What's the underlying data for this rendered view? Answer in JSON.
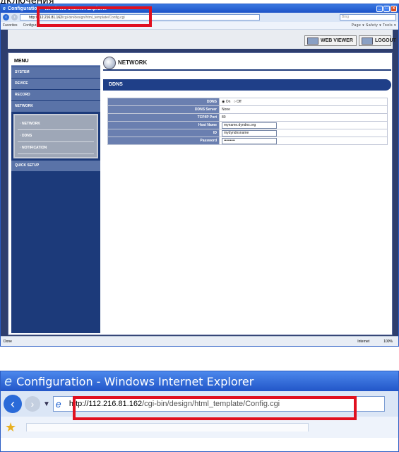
{
  "caption": "дключения",
  "browser": {
    "title": "Configuration - Windows Internet Explorer",
    "address_host": "http://112.216.81.162",
    "address_path": "/cgi-bin/design/html_template/Config.cgi",
    "search_placeholder": "Bing",
    "favorites_label": "Favorites",
    "favorites_tab": "Configuration",
    "toolbar_right": "Page ▾  Safety ▾  Tools ▾",
    "status_left": "Done",
    "status_zone": "Internet",
    "status_zoom": "100%"
  },
  "header": {
    "web_viewer": "WEB VIEWER",
    "logout": "LOGOUT"
  },
  "menu": {
    "title": "MENU",
    "items": [
      "SYSTEM",
      "DEVICE",
      "RECORD",
      "NETWORK"
    ],
    "subitems": [
      "· NETWORK",
      "· DDNS",
      "· NOTIFICATION"
    ],
    "quick_setup": "QUICK SETUP"
  },
  "content": {
    "section_title": "NETWORK",
    "panel_title": "DDNS",
    "rows": [
      {
        "label": "DDNS",
        "on": "On",
        "off": "Off"
      },
      {
        "label": "DDNS Server",
        "value": "None"
      },
      {
        "label": "TCP/IP Port",
        "value": "80"
      },
      {
        "label": "Host Name",
        "value": "myname.dyndns.org"
      },
      {
        "label": "ID",
        "value": "mydyndnsname"
      },
      {
        "label": "Password",
        "value": "•••••••••"
      }
    ]
  },
  "colors": {
    "highlight": "#e01020",
    "menu_bg": "#1c3a7a",
    "panel_header": "#1f3f88"
  }
}
